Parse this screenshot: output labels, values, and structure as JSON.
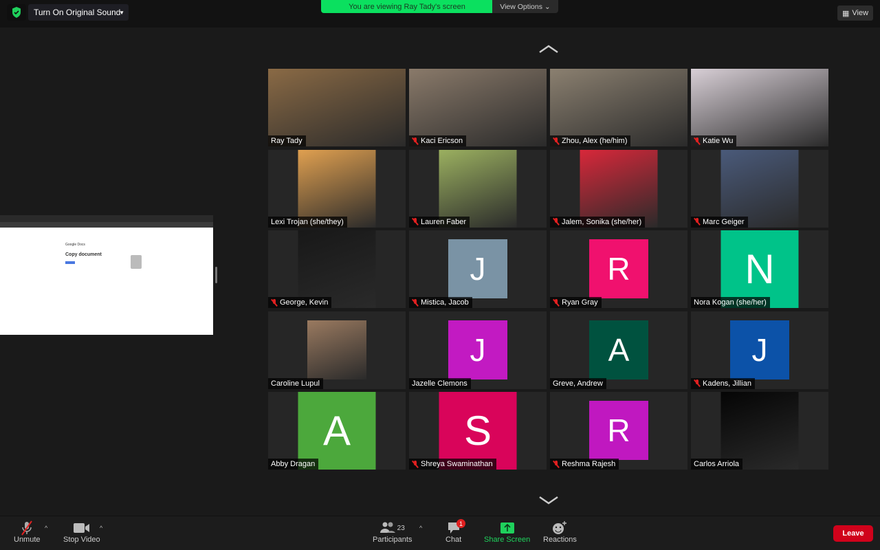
{
  "top": {
    "original_sound": "Turn On Original Sound",
    "banner": "You are viewing Ray Tady's screen",
    "view_options": "View Options",
    "view": "View"
  },
  "shared_screen": {
    "app": "Google Docs",
    "heading": "Copy document"
  },
  "participants": [
    {
      "name": "Ray Tady",
      "muted": false,
      "active": true,
      "type": "photo",
      "color": "#8a6a45"
    },
    {
      "name": "Kaci Ericson",
      "muted": true,
      "type": "photo",
      "color": "#8a7a6a"
    },
    {
      "name": "Zhou, Alex (he/him)",
      "muted": true,
      "type": "photo",
      "color": "#8b8070"
    },
    {
      "name": "Katie Wu",
      "muted": true,
      "type": "photo",
      "color": "#d8cfd6"
    },
    {
      "name": "Lexi Trojan (she/they)",
      "muted": false,
      "type": "photo",
      "color": "#e0a050"
    },
    {
      "name": "Lauren Faber",
      "muted": true,
      "type": "photo",
      "color": "#9bb060"
    },
    {
      "name": "Jalem, Sonika (she/her)",
      "muted": true,
      "type": "photo",
      "color": "#d8283a"
    },
    {
      "name": "Marc Geiger",
      "muted": true,
      "type": "photo",
      "color": "#4a5a7a"
    },
    {
      "name": "George, Kevin",
      "muted": true,
      "type": "photo",
      "color": "#181818"
    },
    {
      "name": "Mistica, Jacob",
      "muted": true,
      "type": "letter",
      "letter": "J",
      "color": "#7a93a5"
    },
    {
      "name": "Ryan Gray",
      "muted": true,
      "type": "letter",
      "letter": "R",
      "color": "#f0116e"
    },
    {
      "name": "Nora Kogan (she/her)",
      "muted": false,
      "type": "letter",
      "letter": "N",
      "color": "#00c389",
      "big": true
    },
    {
      "name": "Caroline Lupul",
      "muted": false,
      "type": "photo",
      "color": "#9a7a60",
      "small": true
    },
    {
      "name": "Jazelle Clemons",
      "muted": false,
      "type": "letter",
      "letter": "J",
      "color": "#c21ac2"
    },
    {
      "name": "Greve, Andrew",
      "muted": false,
      "type": "letter",
      "letter": "A",
      "color": "#00523f"
    },
    {
      "name": "Kadens, Jillian",
      "muted": true,
      "type": "letter",
      "letter": "J",
      "color": "#0c52a8"
    },
    {
      "name": "Abby Dragan",
      "muted": false,
      "type": "letter",
      "letter": "A",
      "color": "#4ca83c",
      "big": true
    },
    {
      "name": "Shreya Swaminathan",
      "muted": true,
      "type": "letter",
      "letter": "S",
      "color": "#d9045a",
      "big": true
    },
    {
      "name": "Reshma Rajesh",
      "muted": true,
      "type": "letter",
      "letter": "R",
      "color": "#c018c0"
    },
    {
      "name": "Carlos Arriola",
      "muted": false,
      "type": "photo",
      "color": "#050505"
    }
  ],
  "toolbar": {
    "unmute": "Unmute",
    "stop_video": "Stop Video",
    "participants": "Participants",
    "participant_count": "23",
    "chat": "Chat",
    "chat_badge": "1",
    "share_screen": "Share Screen",
    "reactions": "Reactions",
    "leave": "Leave"
  }
}
